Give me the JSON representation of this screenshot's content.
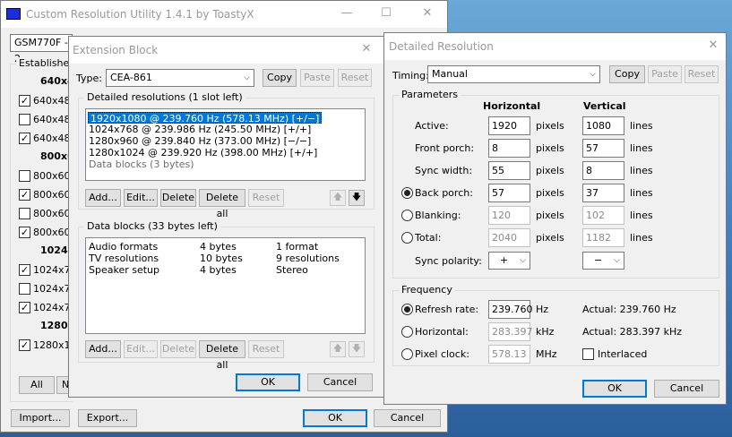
{
  "main_window": {
    "title": "Custom Resolution Utility 1.4.1 by ToastyX",
    "monitor": "GSM770F - 2",
    "established_label": "Established",
    "rows": [
      {
        "label": "640x48",
        "bold": true
      },
      {
        "label": "640x480",
        "checked": true
      },
      {
        "label": "640x480",
        "checked": false
      },
      {
        "label": "640x480",
        "checked": true
      },
      {
        "label": "800x60",
        "bold": true
      },
      {
        "label": "800x600",
        "checked": false
      },
      {
        "label": "800x600",
        "checked": true
      },
      {
        "label": "800x600",
        "checked": false
      },
      {
        "label": "800x600",
        "checked": true
      },
      {
        "label": "1024x7",
        "bold": true
      },
      {
        "label": "1024x76",
        "checked": true
      },
      {
        "label": "1024x76",
        "checked": false
      },
      {
        "label": "1024x76",
        "checked": true
      },
      {
        "label": "1280x1",
        "bold": true
      },
      {
        "label": "1280x10",
        "checked": true
      }
    ],
    "all_btn": "All",
    "none_btn": "No",
    "import_btn": "Import...",
    "export_btn": "Export...",
    "ok_btn": "OK",
    "cancel_btn": "Cancel"
  },
  "ext_block": {
    "title": "Extension Block",
    "type_label": "Type:",
    "type_value": "CEA-861",
    "copy_btn": "Copy",
    "paste_btn": "Paste",
    "reset_btn": "Reset",
    "detailed_title": "Detailed resolutions (1 slot left)",
    "detailed_items": [
      {
        "text": "1920x1080 @ 239.760 Hz (578.13 MHz) [+/−]",
        "selected": true
      },
      {
        "text": "1024x768 @ 239.986 Hz (245.50 MHz) [+/+]"
      },
      {
        "text": "1280x960 @ 239.840 Hz (373.00 MHz) [−/−]"
      },
      {
        "text": "1280x1024 @ 239.920 Hz (398.00 MHz) [+/+]"
      },
      {
        "text": "Data blocks (3 bytes)",
        "gray": true
      }
    ],
    "detailed_buttons": {
      "add": "Add...",
      "edit": "Edit...",
      "delete": "Delete",
      "delete_all": "Delete all",
      "reset": "Reset"
    },
    "data_title": "Data blocks (33 bytes left)",
    "data_items": [
      {
        "name": "Audio formats",
        "size": "4 bytes",
        "info": "1 format"
      },
      {
        "name": "TV resolutions",
        "size": "10 bytes",
        "info": "9 resolutions"
      },
      {
        "name": "Speaker setup",
        "size": "4 bytes",
        "info": "Stereo"
      }
    ],
    "data_buttons": {
      "add": "Add...",
      "edit": "Edit...",
      "delete": "Delete",
      "delete_all": "Delete all",
      "reset": "Reset"
    },
    "ok_btn": "OK",
    "cancel_btn": "Cancel"
  },
  "detailed": {
    "title": "Detailed Resolution",
    "timing_label": "Timing:",
    "timing_value": "Manual",
    "copy_btn": "Copy",
    "paste_btn": "Paste",
    "reset_btn": "Reset",
    "params_title": "Parameters",
    "horizontal_header": "Horizontal",
    "vertical_header": "Vertical",
    "rows": [
      {
        "label": "Active:",
        "h": "1920",
        "v": "1080",
        "radio": false
      },
      {
        "label": "Front porch:",
        "h": "8",
        "v": "57",
        "radio": false
      },
      {
        "label": "Sync width:",
        "h": "55",
        "v": "8",
        "radio": false
      },
      {
        "label": "Back porch:",
        "h": "57",
        "v": "37",
        "radio": true,
        "on": true
      },
      {
        "label": "Blanking:",
        "h": "120",
        "v": "102",
        "radio": true,
        "on": false,
        "disabled": true
      },
      {
        "label": "Total:",
        "h": "2040",
        "v": "1182",
        "radio": true,
        "on": false,
        "disabled": true
      }
    ],
    "pixels_unit": "pixels",
    "lines_unit": "lines",
    "sync_label": "Sync polarity:",
    "sync_h": "+",
    "sync_v": "−",
    "freq_title": "Frequency",
    "refresh_label": "Refresh rate:",
    "refresh_value": "239.760",
    "refresh_unit": "Hz",
    "refresh_actual": "Actual: 239.760 Hz",
    "horiz_label": "Horizontal:",
    "horiz_value": "283.397",
    "horiz_unit": "kHz",
    "horiz_actual": "Actual: 283.397 kHz",
    "pclk_label": "Pixel clock:",
    "pclk_value": "578.13",
    "pclk_unit": "MHz",
    "interlaced_label": "Interlaced",
    "ok_btn": "OK",
    "cancel_btn": "Cancel"
  }
}
